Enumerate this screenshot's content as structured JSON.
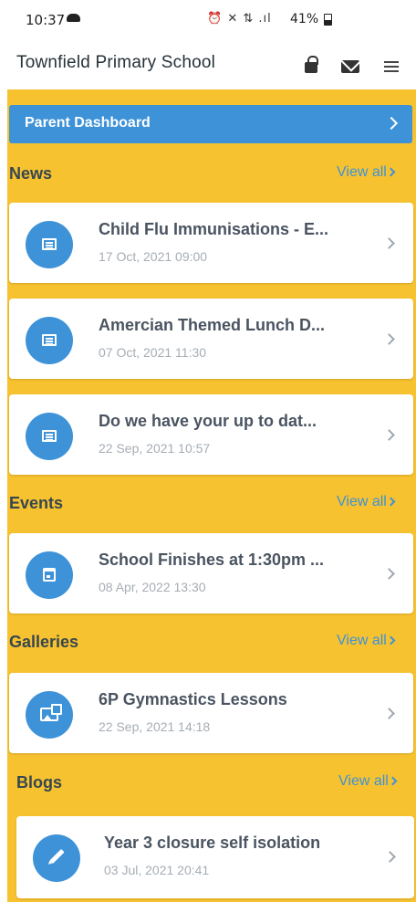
{
  "status_bar": {
    "time": "10:37",
    "icons": "⏰ ✕ ⇅ .ıl",
    "battery": "41%"
  },
  "header": {
    "title": "Townfield Primary School"
  },
  "dashboard": {
    "label": "Parent Dashboard"
  },
  "sections": {
    "news": {
      "title": "News",
      "view_all": "View all",
      "items": [
        {
          "title": "Child Flu Immunisations - E...",
          "date": "17 Oct, 2021 09:00"
        },
        {
          "title": "Amercian Themed Lunch D...",
          "date": "07 Oct, 2021 11:30"
        },
        {
          "title": "Do we have your up to dat...",
          "date": "22 Sep, 2021 10:57"
        }
      ]
    },
    "events": {
      "title": "Events",
      "view_all": "View all",
      "items": [
        {
          "title": "School Finishes at 1:30pm ...",
          "date": "08 Apr, 2022 13:30"
        }
      ]
    },
    "galleries": {
      "title": "Galleries",
      "view_all": "View all",
      "items": [
        {
          "title": "6P Gymnastics Lessons",
          "date": "22 Sep, 2021 14:18"
        }
      ]
    },
    "blogs": {
      "title": "Blogs",
      "view_all": "View all",
      "items": [
        {
          "title": "Year 3 closure self isolation",
          "date": "03 Jul, 2021 20:41"
        }
      ]
    }
  },
  "colors": {
    "accent": "#3e92d8",
    "panel": "#f7c22f"
  }
}
